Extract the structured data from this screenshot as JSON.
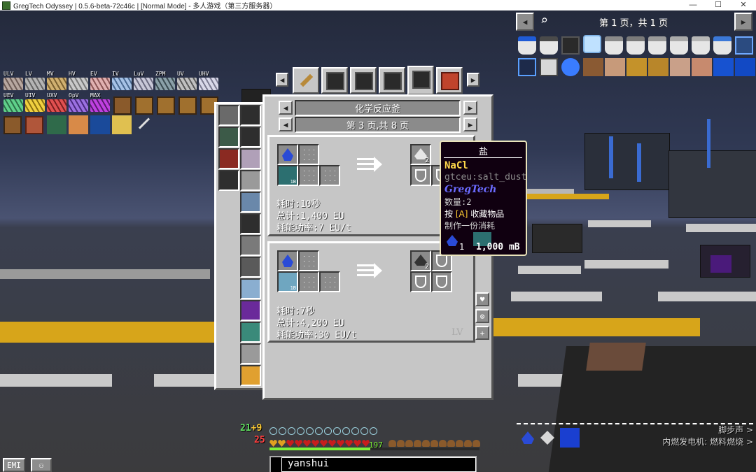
{
  "window": {
    "title": "GregTech Odyssey | 0.5.6-beta-72c46c | [Normal Mode] - 多人游戏（第三方服务器）",
    "controls": [
      "—",
      "☐",
      "✕"
    ]
  },
  "emi": {
    "page_indicator": "第 1 页，共 1 页",
    "prev_label": "◀",
    "next_label": "▶",
    "search_icon": "magnifier-icon",
    "left_label": "EMI"
  },
  "tier_labels": [
    "ULV",
    "LV",
    "MV",
    "HV",
    "EV",
    "IV",
    "LuV",
    "ZPM",
    "UV",
    "UHV",
    "UEV",
    "UIV",
    "UXV",
    "OpV",
    "MAX"
  ],
  "recipe_window": {
    "tab_prev": "◀",
    "tab_next": "▶",
    "category": {
      "prev": "◀",
      "label": "化学反应釜",
      "next": "▶"
    },
    "page": {
      "prev": "◀",
      "label": "第 3 页,共 8 页",
      "next": "▶"
    },
    "recipes": [
      {
        "time": "耗时:10秒",
        "total": "总计:1,400 EU",
        "power": "耗能功率:7 EU/t",
        "output_count": "2"
      },
      {
        "time": "耗时:7秒",
        "total": "总计:4,200 EU",
        "power": "耗能功率:30 EU/t",
        "output_count": "2",
        "tier": "LV"
      }
    ],
    "input_fluid_amount": "1B",
    "side_buttons": [
      "♥",
      "⚙",
      "+"
    ]
  },
  "tooltip": {
    "title": "盐",
    "formula": "NaCl",
    "id": "gtceu:salt_dust",
    "mod": "GregTech",
    "count": "数量:2",
    "favorite_prefix": "按",
    "favorite_key": "[A]",
    "favorite_suffix": "收藏物品",
    "consume": "制作一份消耗",
    "cost_item_count": "1",
    "cost_fluid": "1,000 mB",
    "colors": {
      "formula": "#ffd84a",
      "mod": "#6b6bff",
      "id": "#8c8c8c",
      "key": "#ffcc33"
    }
  },
  "hud": {
    "armor": "21",
    "armor_plus": "+",
    "armor_extra": "9",
    "health": "25",
    "xp_level": "197",
    "chat_input": "yanshui",
    "subtitle1": "脚步声",
    "subtitle2": "内燃发电机: 燃料燃烧 >",
    "subtitle_arrow": ">"
  }
}
